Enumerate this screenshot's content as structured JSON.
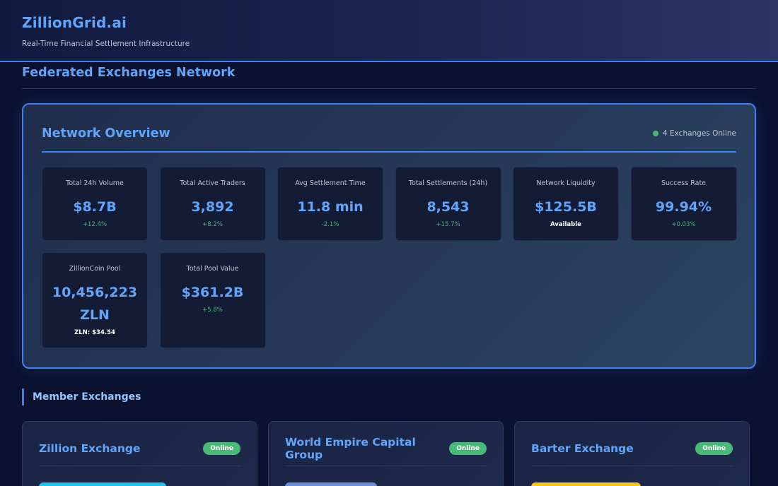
{
  "header": {
    "brand": "ZillionGrid.ai",
    "tagline": "Real-Time Financial Settlement Infrastructure"
  },
  "page": {
    "title": "Federated Exchanges Network"
  },
  "overview": {
    "title": "Network Overview",
    "status": "4 Exchanges Online",
    "stats": [
      {
        "label": "Total 24h Volume",
        "value": "$8.7B",
        "sub": "+12.4%"
      },
      {
        "label": "Total Active Traders",
        "value": "3,892",
        "sub": "+8.2%"
      },
      {
        "label": "Avg Settlement Time",
        "value": "11.8 min",
        "sub": "-2.1%"
      },
      {
        "label": "Total Settlements (24h)",
        "value": "8,543",
        "sub": "+15.7%"
      },
      {
        "label": "Network Liquidity",
        "value": "$125.5B",
        "sub": "Available"
      },
      {
        "label": "Success Rate",
        "value": "99.94%",
        "sub": "+0.03%"
      },
      {
        "label": "ZillionCoin Pool",
        "value": "10,456,223 ZLN",
        "sub": "ZLN: $34.54"
      },
      {
        "label": "Total Pool Value",
        "value": "$361.2B",
        "sub": "+5.8%"
      }
    ]
  },
  "members": {
    "title": "Member Exchanges",
    "exchanges": [
      {
        "name": "Zillion Exchange",
        "status": "Online",
        "color": "#22c3e6"
      },
      {
        "name": "World Empire Capital Group",
        "status": "Online",
        "color": "#6b8fd8"
      },
      {
        "name": "Barter Exchange",
        "status": "Online",
        "color": "#f5c518"
      }
    ]
  }
}
